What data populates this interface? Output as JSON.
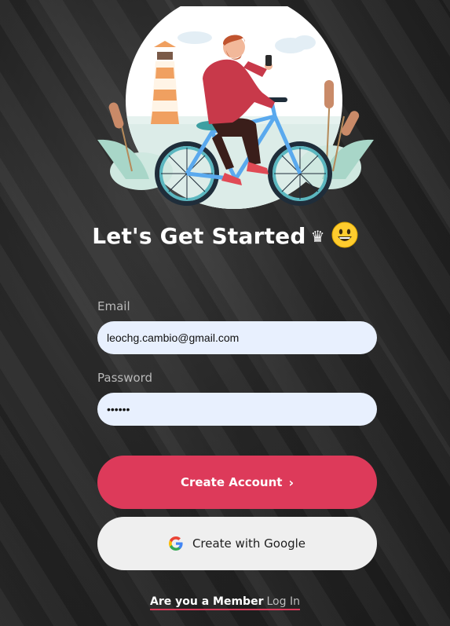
{
  "page": {
    "title": "Let's Get Started",
    "title_emoji": "♛"
  },
  "form": {
    "email_label": "Email",
    "email_value": "leochg.cambio@gmail.com",
    "password_label": "Password",
    "password_value": "••••••"
  },
  "buttons": {
    "create_account": "Create Account",
    "create_account_icon": "chevron-right-icon",
    "google": "Create with Google",
    "google_icon": "google-icon"
  },
  "footer": {
    "member_question": "Are you a Member",
    "login_link": "Log In"
  },
  "colors": {
    "accent": "#dd3a5a",
    "input_bg": "#e8f0fe",
    "google_btn_bg": "#efefef"
  }
}
